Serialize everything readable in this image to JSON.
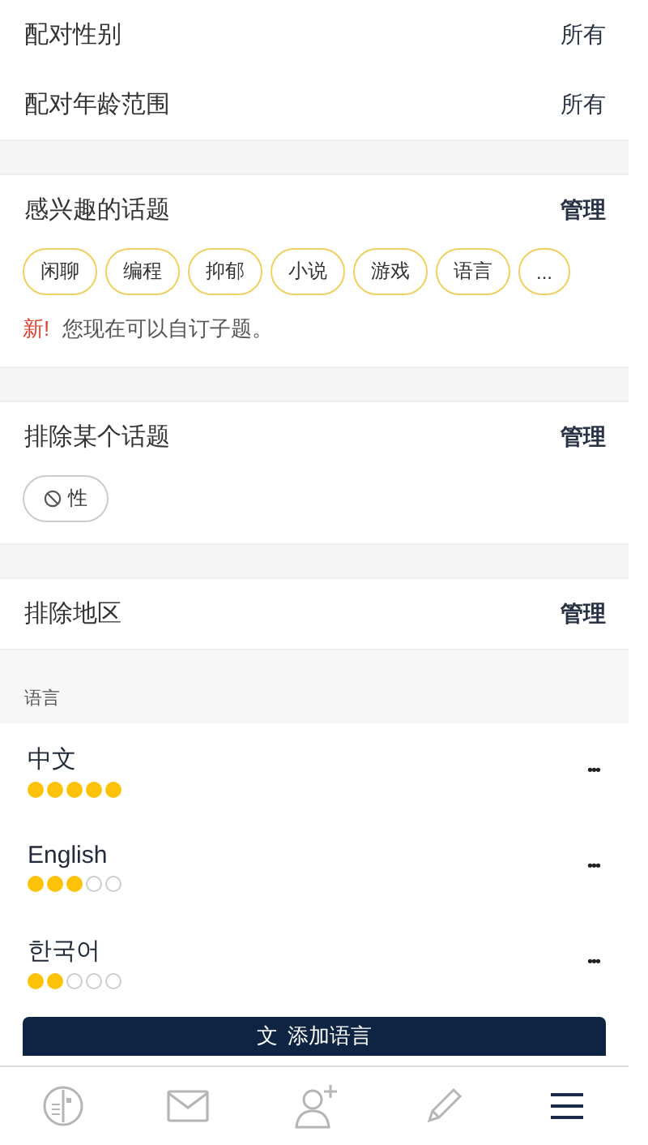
{
  "match_settings": [
    {
      "label": "配对性别",
      "value": "所有"
    },
    {
      "label": "配对年龄范围",
      "value": "所有"
    }
  ],
  "interests": {
    "title": "感兴趣的话题",
    "action": "管理",
    "tags": [
      "闲聊",
      "编程",
      "抑郁",
      "小说",
      "游戏",
      "语言",
      "..."
    ],
    "new_badge": "新!",
    "notice": "您现在可以自订子题。"
  },
  "excluded_topics": {
    "title": "排除某个话题",
    "action": "管理",
    "tags": [
      "性"
    ]
  },
  "excluded_regions": {
    "title": "排除地区",
    "action": "管理"
  },
  "languages_header": "语言",
  "languages": [
    {
      "name": "中文",
      "stars": 5,
      "menu": "•••"
    },
    {
      "name": "English",
      "stars": 3,
      "menu": "•••"
    },
    {
      "name": "한국어",
      "stars": 2,
      "menu": "•••"
    }
  ],
  "add_language_button": {
    "icon": "文",
    "label": "添加语言"
  },
  "tab_bar": [
    {
      "kind": "compass",
      "selected": false
    },
    {
      "kind": "mail",
      "selected": false
    },
    {
      "kind": "add-person",
      "selected": false
    },
    {
      "kind": "pencil",
      "selected": false
    },
    {
      "kind": "list",
      "selected": true
    }
  ]
}
